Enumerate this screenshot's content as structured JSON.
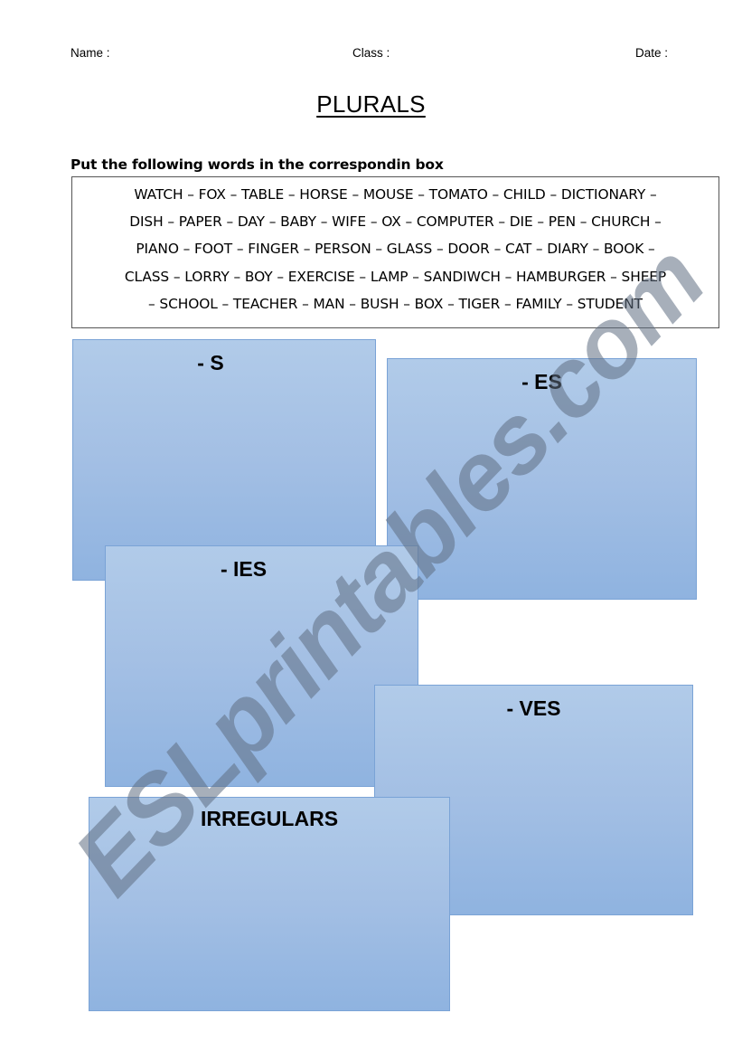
{
  "header": {
    "name_label": "Name :",
    "class_label": "Class :",
    "date_label": "Date :"
  },
  "title": "PLURALS",
  "instructions": "Put the following words in the correspondin box",
  "word_bank": {
    "lines": [
      "WATCH – FOX – TABLE – HORSE – MOUSE – TOMATO – CHILD – DICTIONARY –",
      "DISH – PAPER – DAY – BABY – WIFE – OX – COMPUTER – DIE – PEN – CHURCH –",
      "PIANO – FOOT – FINGER – PERSON – GLASS – DOOR – CAT – DIARY – BOOK –",
      "CLASS – LORRY – BOY – EXERCISE – LAMP – SANDIWCH – HAMBURGER – SHEEP",
      "– SCHOOL – TEACHER – MAN – BUSH – BOX – TIGER – FAMILY – STUDENT"
    ],
    "words": [
      "WATCH",
      "FOX",
      "TABLE",
      "HORSE",
      "MOUSE",
      "TOMATO",
      "CHILD",
      "DICTIONARY",
      "DISH",
      "PAPER",
      "DAY",
      "BABY",
      "WIFE",
      "OX",
      "COMPUTER",
      "DIE",
      "PEN",
      "CHURCH",
      "PIANO",
      "FOOT",
      "FINGER",
      "PERSON",
      "GLASS",
      "DOOR",
      "CAT",
      "DIARY",
      "BOOK",
      "CLASS",
      "LORRY",
      "BOY",
      "EXERCISE",
      "LAMP",
      "SANDIWCH",
      "HAMBURGER",
      "SHEEP",
      "SCHOOL",
      "TEACHER",
      "MAN",
      "BUSH",
      "BOX",
      "TIGER",
      "FAMILY",
      "STUDENT"
    ]
  },
  "categories": [
    {
      "id": "s",
      "label": "- S"
    },
    {
      "id": "es",
      "label": "- ES"
    },
    {
      "id": "ies",
      "label": "- IES"
    },
    {
      "id": "ves",
      "label": "- VES"
    },
    {
      "id": "irregulars",
      "label": "IRREGULARS"
    }
  ],
  "colors": {
    "box_fill_top": "#b1cbe9",
    "box_fill_bottom": "#8fb3e0",
    "box_border": "#7aa3d6",
    "watermark": "#5f6e82"
  },
  "watermark": "ESLprintables.com"
}
